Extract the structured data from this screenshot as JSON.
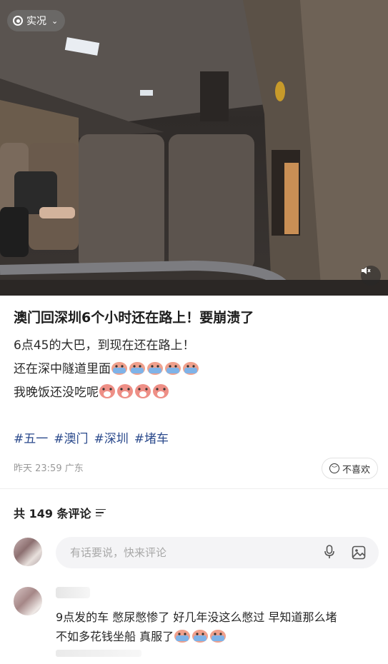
{
  "photo": {
    "live_label": "实况",
    "chevron_icon": "chevron-down-icon",
    "sound_icon": "sound-off-icon"
  },
  "post": {
    "title": "澳门回深圳6个小时还在路上！要崩溃了",
    "line1": "6点45的大巴，到现在还在路上！",
    "line2": "还在深中隧道里面",
    "line3": "我晚饭还没吃呢",
    "emoji_line2": "crying-emoji",
    "emoji_line3": "sad-emoji",
    "tags": [
      "#五一",
      "#澳门",
      "#深圳",
      "#堵车"
    ],
    "time": "昨天 23:59",
    "location": "广东",
    "dislike_label": "不喜欢"
  },
  "comments": {
    "header": "共 149 条评论",
    "input_placeholder": "有话要说，快来评论",
    "first": {
      "line1": "9点发的车  憋尿憋惨了 好几年没这么憋过 早知道那么堵",
      "line2": "不如多花钱坐船 真服了"
    }
  },
  "colors": {
    "tag": "#2b4a8c",
    "muted": "#9a9a9a",
    "input_bg": "#f4f4f6"
  }
}
